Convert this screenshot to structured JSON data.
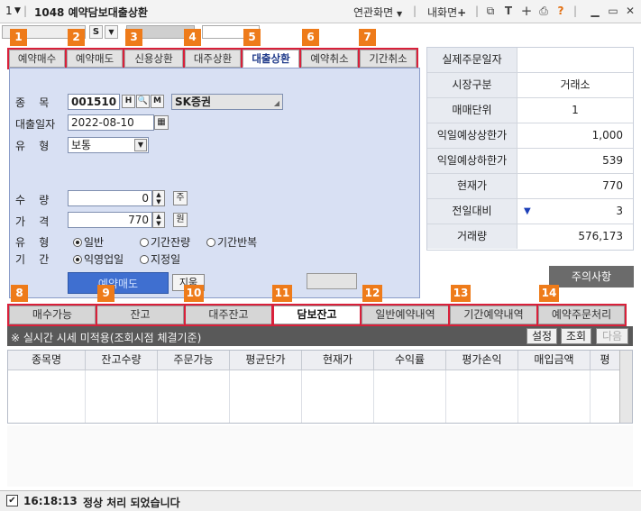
{
  "window": {
    "number": "1",
    "title": "1048 예약담보대출상환",
    "menu_related": "연관화면",
    "menu_my": "내화면",
    "help": "?"
  },
  "subbar": {
    "s_label": "S"
  },
  "order_tabs": [
    {
      "label": "예약매수",
      "badge": "1"
    },
    {
      "label": "예약매도",
      "badge": "2"
    },
    {
      "label": "신용상환",
      "badge": "3"
    },
    {
      "label": "대주상환",
      "badge": "4"
    },
    {
      "label": "대출상환",
      "badge": "5"
    },
    {
      "label": "예약취소",
      "badge": "6"
    },
    {
      "label": "기간취소",
      "badge": "7"
    }
  ],
  "form": {
    "stock_label": "종    목",
    "stock_code": "001510",
    "stock_btn_h": "H",
    "stock_btn_q": "Q",
    "stock_btn_m": "M",
    "stock_name": "SK증권",
    "loan_date_label": "대출일자",
    "loan_date": "2022-08-10",
    "type_label": "유    형",
    "type_value": "보통",
    "qty_label": "수    량",
    "qty_value": "0",
    "qty_unit": "주",
    "price_label": "가    격",
    "price_value": "770",
    "price_unit": "원",
    "kind_label": "유    형",
    "kind_opt1": "일반",
    "kind_opt2": "기간잔량",
    "kind_opt3": "기간반복",
    "period_label": "기    간",
    "period_opt1": "익영업일",
    "period_opt2": "지정일",
    "submit": "예약매도",
    "reset": "지움"
  },
  "info": [
    {
      "key": "실제주문일자",
      "value": ""
    },
    {
      "key": "시장구분",
      "value": "거래소"
    },
    {
      "key": "매매단위",
      "value": "1"
    },
    {
      "key": "익일예상상한가",
      "value": "1,000"
    },
    {
      "key": "익일예상하한가",
      "value": "539"
    },
    {
      "key": "현재가",
      "value": "770"
    },
    {
      "key": "전일대비",
      "value": "3",
      "arrow": "▼"
    },
    {
      "key": "거래량",
      "value": "576,173"
    }
  ],
  "caution_button": "주의사항",
  "bottom_tabs": [
    {
      "label": "매수가능",
      "badge": "8"
    },
    {
      "label": "잔고",
      "badge": "9"
    },
    {
      "label": "대주잔고",
      "badge": "10"
    },
    {
      "label": "담보잔고",
      "badge": "11"
    },
    {
      "label": "일반예약내역",
      "badge": "12"
    },
    {
      "label": "기간예약내역",
      "badge": "13"
    },
    {
      "label": "예약주문처리",
      "badge": "14"
    }
  ],
  "strip": {
    "notice": "※ 실시간 시세 미적용(조회시점 체결기준)",
    "settings": "설정",
    "query": "조회",
    "next": "다음"
  },
  "grid_headers": [
    "종목명",
    "잔고수량",
    "주문가능",
    "평균단가",
    "현재가",
    "수익률",
    "평가손익",
    "매입금액",
    "평"
  ],
  "status": {
    "time": "16:18:13",
    "message": "정상 처리 되었습니다"
  },
  "colors": {
    "badge": "#ee7b1a",
    "highlight": "#d9203a",
    "panel": "#d8e0f3",
    "submit": "#3f6fd0"
  }
}
